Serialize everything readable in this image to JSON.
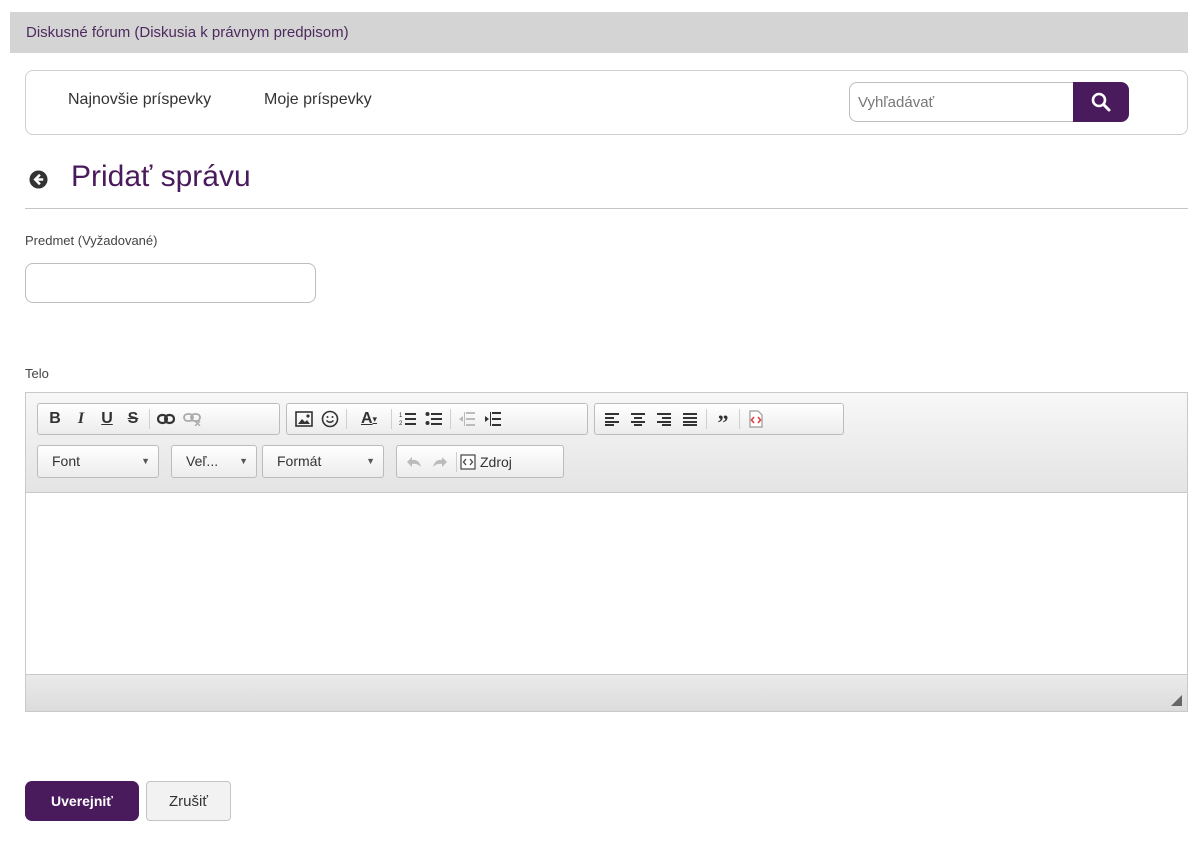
{
  "portlet": {
    "title": "Diskusné fórum (Diskusia k právnym predpisom)"
  },
  "nav": {
    "links": [
      "Najnovšie príspevky",
      "Moje príspevky"
    ],
    "search_placeholder": "Vyhľadávať"
  },
  "page": {
    "title": "Pridať správu"
  },
  "form": {
    "subject_label": "Predmet (Vyžadované)",
    "subject_value": "",
    "body_label": "Telo"
  },
  "editor": {
    "toolbar_groups": [
      [
        "bold-icon",
        "italic-icon",
        "underline-icon",
        "strikethrough-icon",
        "link-icon",
        "unlink-icon"
      ],
      [
        "image-icon",
        "smiley-icon",
        "text-color-icon",
        "numbered-list-icon",
        "bulleted-list-icon",
        "outdent-icon",
        "indent-icon"
      ],
      [
        "align-left-icon",
        "align-center-icon",
        "align-right-icon",
        "align-justify-icon",
        "blockquote-icon",
        "source-code-icon"
      ]
    ],
    "font_combo": "Font",
    "size_combo": "Veľ...",
    "format_combo": "Formát",
    "source_label": "Zdroj"
  },
  "actions": {
    "publish": "Uverejniť",
    "cancel": "Zrušiť"
  },
  "colors": {
    "brand": "#4a1b5c",
    "header_bg": "#d4d4d4"
  }
}
